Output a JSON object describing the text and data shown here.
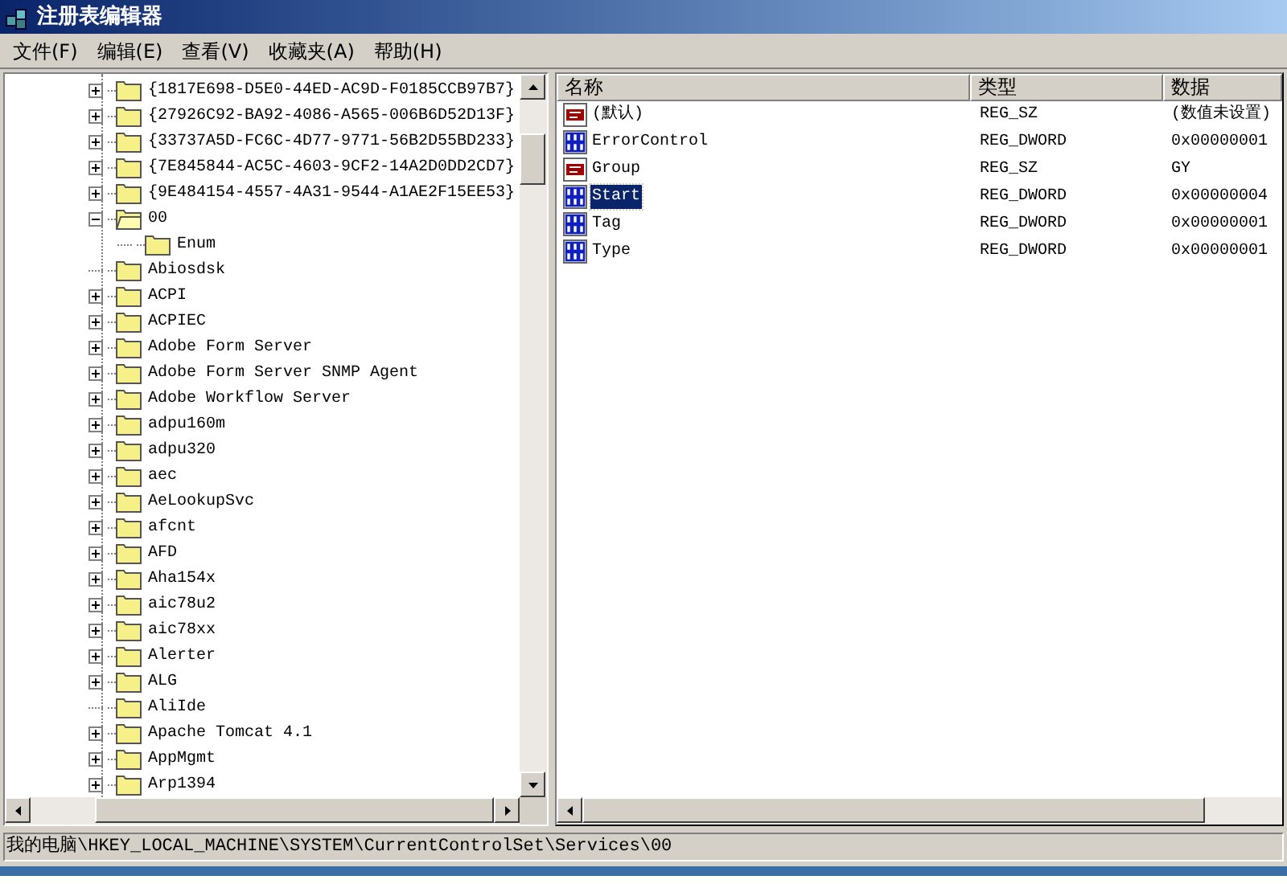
{
  "window": {
    "title": "注册表编辑器"
  },
  "menu": [
    "文件(F)",
    "编辑(E)",
    "查看(V)",
    "收藏夹(A)",
    "帮助(H)"
  ],
  "tree": [
    {
      "label": "{1817E698-D5E0-44ED-AC9D-F0185CCB97B7}",
      "has_children": true,
      "expanded": false
    },
    {
      "label": "{27926C92-BA92-4086-A565-006B6D52D13F}",
      "has_children": true,
      "expanded": false
    },
    {
      "label": "{33737A5D-FC6C-4D77-9771-56B2D55BD233}",
      "has_children": true,
      "expanded": false
    },
    {
      "label": "{7E845844-AC5C-4603-9CF2-14A2D0DD2CD7}",
      "has_children": true,
      "expanded": false
    },
    {
      "label": "{9E484154-4557-4A31-9544-A1AE2F15EE53}",
      "has_children": true,
      "expanded": false
    },
    {
      "label": "00",
      "has_children": true,
      "expanded": true,
      "children": [
        {
          "label": "Enum",
          "has_children": false,
          "expanded": false
        }
      ]
    },
    {
      "label": "Abiosdsk",
      "has_children": false,
      "expanded": false
    },
    {
      "label": "ACPI",
      "has_children": true,
      "expanded": false
    },
    {
      "label": "ACPIEC",
      "has_children": true,
      "expanded": false
    },
    {
      "label": "Adobe Form Server",
      "has_children": true,
      "expanded": false
    },
    {
      "label": "Adobe Form Server SNMP Agent",
      "has_children": true,
      "expanded": false
    },
    {
      "label": "Adobe Workflow Server",
      "has_children": true,
      "expanded": false
    },
    {
      "label": "adpu160m",
      "has_children": true,
      "expanded": false
    },
    {
      "label": "adpu320",
      "has_children": true,
      "expanded": false
    },
    {
      "label": "aec",
      "has_children": true,
      "expanded": false
    },
    {
      "label": "AeLookupSvc",
      "has_children": true,
      "expanded": false
    },
    {
      "label": "afcnt",
      "has_children": true,
      "expanded": false
    },
    {
      "label": "AFD",
      "has_children": true,
      "expanded": false
    },
    {
      "label": "Aha154x",
      "has_children": true,
      "expanded": false
    },
    {
      "label": "aic78u2",
      "has_children": true,
      "expanded": false
    },
    {
      "label": "aic78xx",
      "has_children": true,
      "expanded": false
    },
    {
      "label": "Alerter",
      "has_children": true,
      "expanded": false
    },
    {
      "label": "ALG",
      "has_children": true,
      "expanded": false
    },
    {
      "label": "AliIde",
      "has_children": false,
      "expanded": false
    },
    {
      "label": "Apache Tomcat 4.1",
      "has_children": true,
      "expanded": false
    },
    {
      "label": "AppMgmt",
      "has_children": true,
      "expanded": false
    },
    {
      "label": "Arp1394",
      "has_children": true,
      "expanded": false
    }
  ],
  "values": {
    "columns": [
      "名称",
      "类型",
      "数据"
    ],
    "rows": [
      {
        "kind": "string",
        "name": "(默认)",
        "type": "REG_SZ",
        "data": "(数值未设置)",
        "selected": false
      },
      {
        "kind": "binary",
        "name": "ErrorControl",
        "type": "REG_DWORD",
        "data": "0x00000001",
        "selected": false
      },
      {
        "kind": "string",
        "name": "Group",
        "type": "REG_SZ",
        "data": "GY",
        "selected": false
      },
      {
        "kind": "binary",
        "name": "Start",
        "type": "REG_DWORD",
        "data": "0x00000004",
        "selected": true
      },
      {
        "kind": "binary",
        "name": "Tag",
        "type": "REG_DWORD",
        "data": "0x00000001",
        "selected": false
      },
      {
        "kind": "binary",
        "name": "Type",
        "type": "REG_DWORD",
        "data": "0x00000001",
        "selected": false
      }
    ]
  },
  "status_bar": "我的电脑\\HKEY_LOCAL_MACHINE\\SYSTEM\\CurrentControlSet\\Services\\00"
}
